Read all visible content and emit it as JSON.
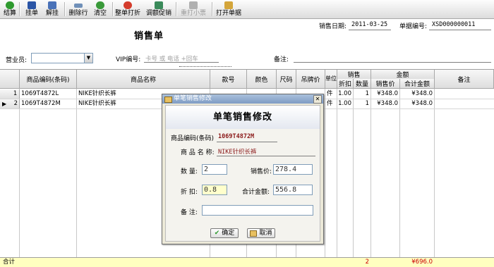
{
  "toolbar": {
    "buttons": [
      {
        "label": "结算",
        "icon": "check-icon",
        "color": "#2f9a2f"
      },
      {
        "label": "挂单",
        "icon": "save-icon",
        "color": "#2b55a6"
      },
      {
        "label": "解挂",
        "icon": "document-icon",
        "color": "#4a72b8"
      },
      {
        "label": "删除行",
        "icon": "delete-row-icon",
        "color": "#6f8fb8"
      },
      {
        "label": "清空",
        "icon": "refresh-icon",
        "color": "#3a9a3a"
      },
      {
        "label": "整单打折",
        "icon": "discount-icon",
        "color": "#d43c2c"
      },
      {
        "label": "调额促销",
        "icon": "promo-icon",
        "color": "#3a8a5a"
      },
      {
        "label": "重打小票",
        "icon": "printer-icon",
        "color": "#b0b0b0"
      },
      {
        "label": "打开单据",
        "icon": "folder-icon",
        "color": "#d4a53a"
      }
    ]
  },
  "form": {
    "title": "销售单",
    "sale_date_label": "销售日期:",
    "sale_date": "2011-03-25",
    "doc_no_label": "单据编号:",
    "doc_no": "XSD000000011",
    "salesperson_label": "营业员:",
    "salesperson_value": "",
    "vip_label": "VIP编号:",
    "vip_placeholder": "卡号 或 电话 +回车",
    "remark_label": "备注:",
    "remark_value": ""
  },
  "grid": {
    "headers": {
      "code": "商品编码(条码)",
      "name": "商品名称",
      "style": "款号",
      "color": "颜色",
      "size": "尺码",
      "tag_price": "吊牌价",
      "unit": "单位",
      "sale_group": "销售",
      "discount": "折扣",
      "qty": "数量",
      "amount_group": "金额",
      "sale_price": "销售价",
      "total": "合计金额",
      "remark": "备注"
    },
    "rows": [
      {
        "num": "1",
        "marker": "",
        "code": "1069T4872L",
        "name": "NIKE针织长裤",
        "unit": "件",
        "discount": "1.00",
        "qty": "1",
        "sale_price": "¥348.0",
        "total": "¥348.0"
      },
      {
        "num": "2",
        "marker": "▶",
        "code": "1069T4872M",
        "name": "NIKE针织长裤",
        "unit": "件",
        "discount": "1.00",
        "qty": "1",
        "sale_price": "¥348.0",
        "total": "¥348.0"
      }
    ],
    "footer": {
      "label": "合计",
      "qty": "2",
      "total": "¥696.0"
    }
  },
  "dialog": {
    "window_title": "单笔销售修改",
    "heading": "单笔销售修改",
    "code_label": "商品编码(条码)",
    "code_value": "1069T4872M",
    "name_label": "商 品 名 称:",
    "name_value": "NIKE针织长裤",
    "qty_label": "数 量:",
    "qty_value": "2",
    "price_label": "销售价:",
    "price_value": "278.4",
    "discount_label": "折 扣:",
    "discount_value": "0.8",
    "total_label": "合计金额:",
    "total_value": "556.8",
    "remark_label": "备 注:",
    "remark_value": "",
    "ok_label": "确定",
    "cancel_label": "取消"
  }
}
